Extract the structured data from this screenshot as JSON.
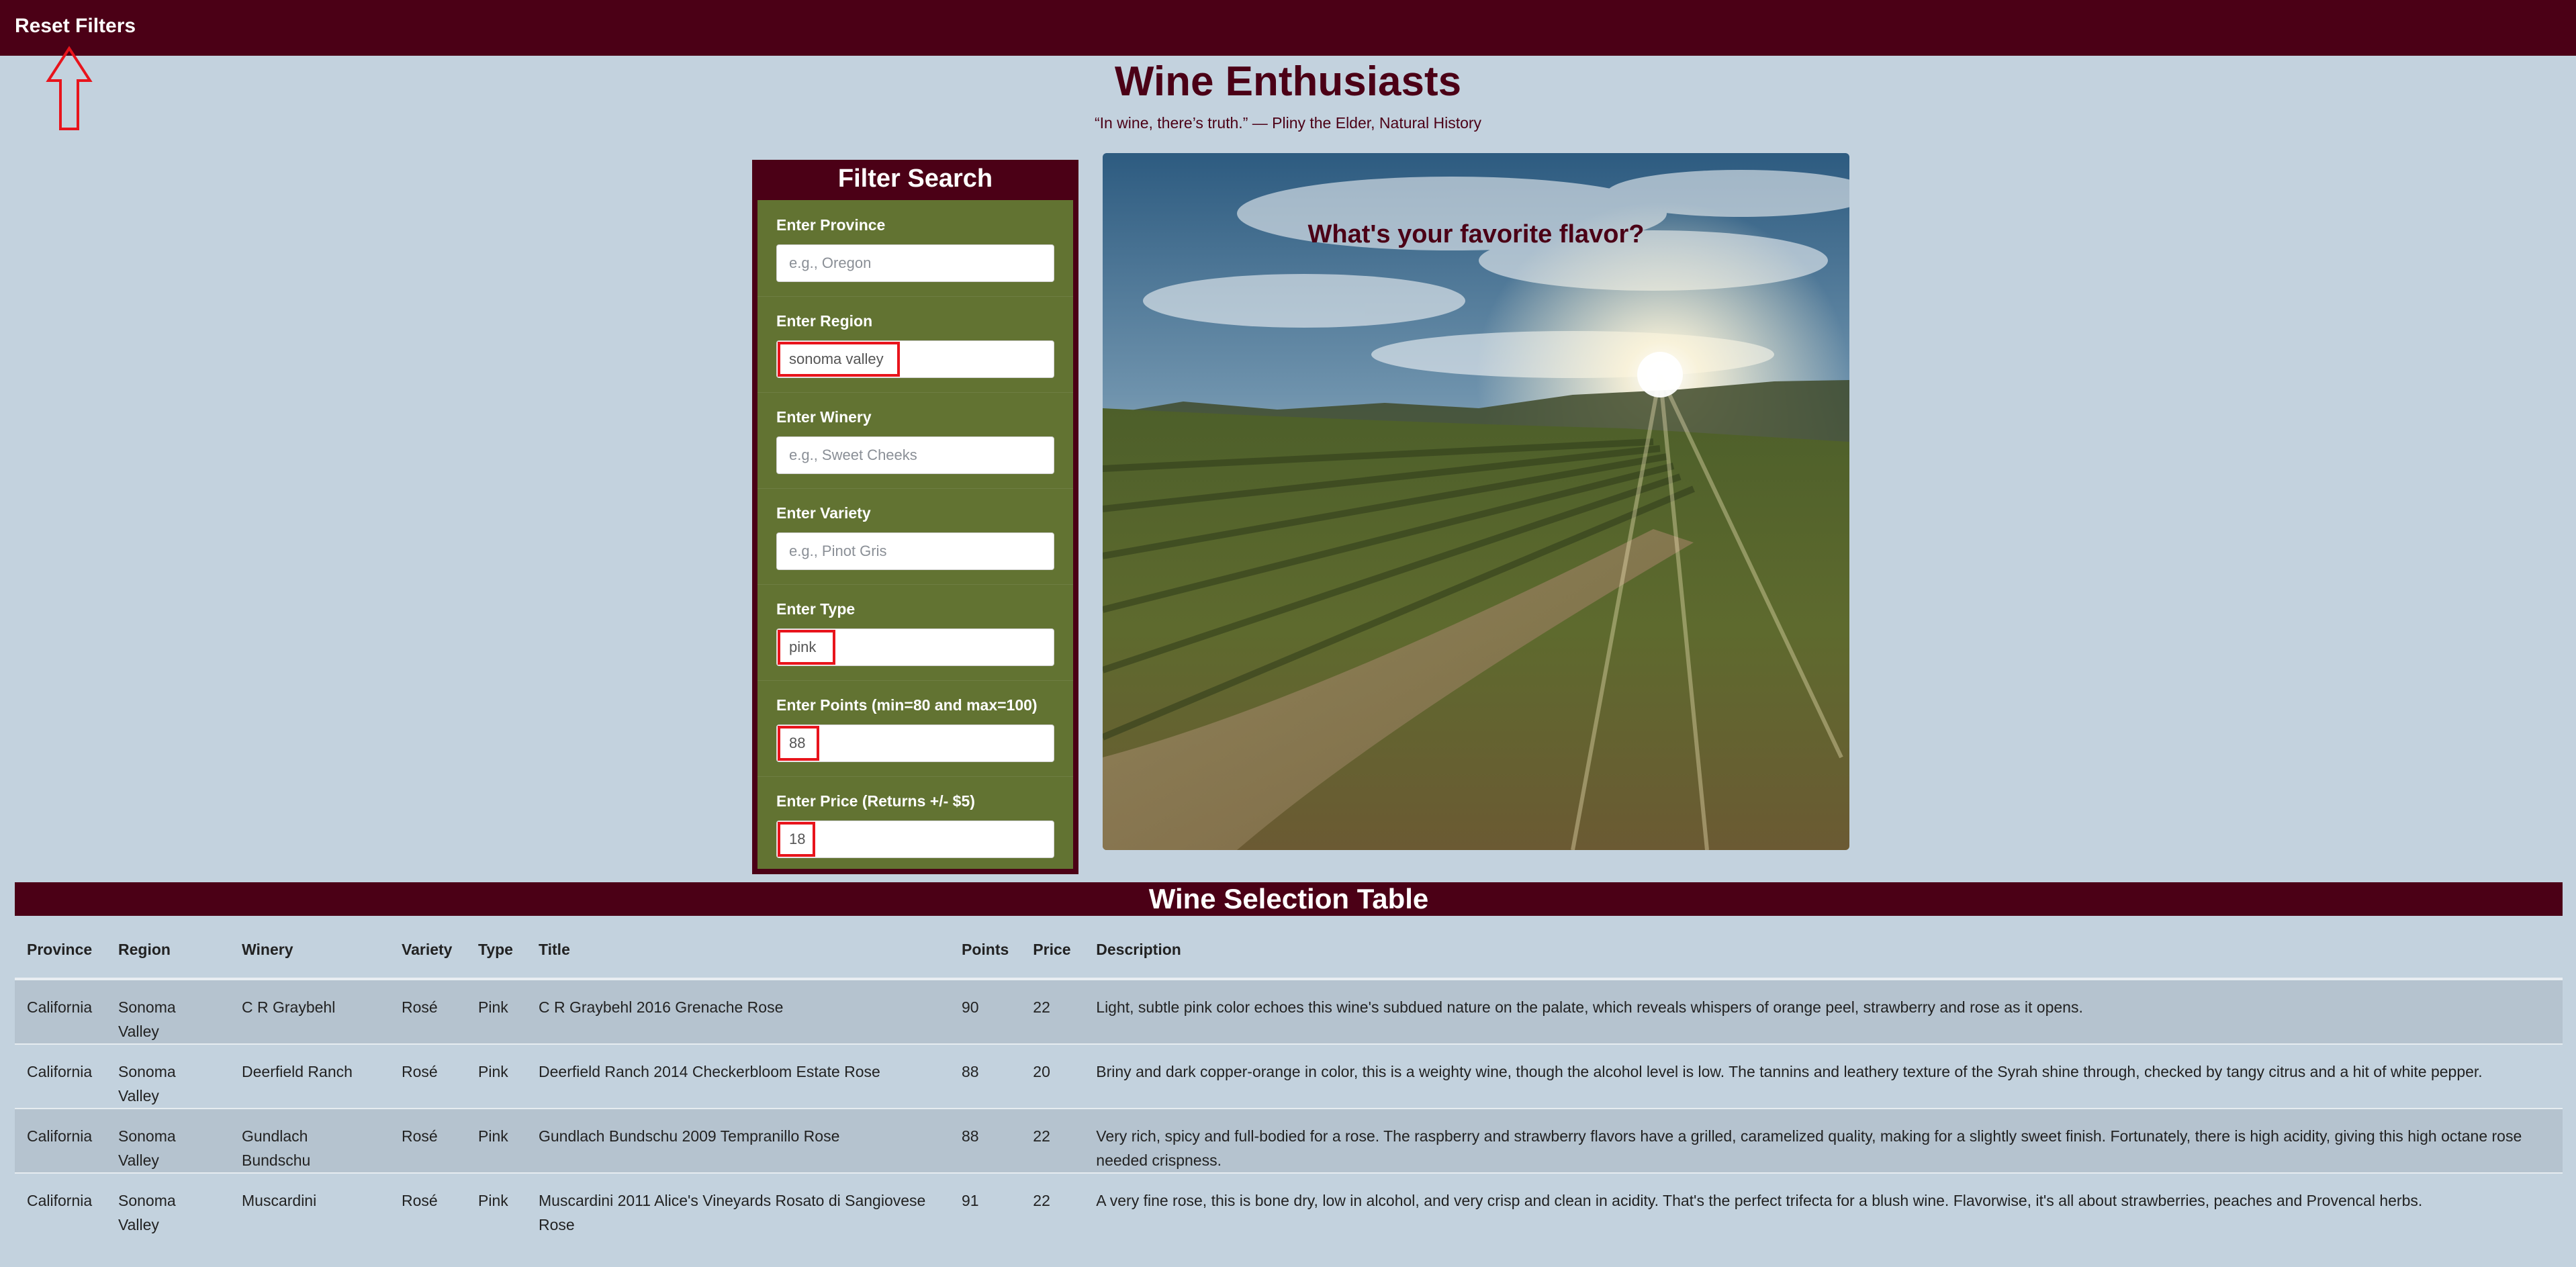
{
  "nav": {
    "reset_label": "Reset Filters"
  },
  "header": {
    "title": "Wine Enthusiasts",
    "quote": "“In wine, there’s truth.” — Pliny the Elder, Natural History"
  },
  "filter": {
    "title": "Filter Search",
    "province": {
      "label": "Enter Province",
      "value": "",
      "placeholder": "e.g., Oregon"
    },
    "region": {
      "label": "Enter Region",
      "value": "sonoma valley",
      "placeholder": ""
    },
    "winery": {
      "label": "Enter Winery",
      "value": "",
      "placeholder": "e.g., Sweet Cheeks"
    },
    "variety": {
      "label": "Enter Variety",
      "value": "",
      "placeholder": "e.g., Pinot Gris"
    },
    "type": {
      "label": "Enter Type",
      "value": "pink",
      "placeholder": ""
    },
    "points": {
      "label": "Enter Points (min=80 and max=100)",
      "value": "88",
      "placeholder": ""
    },
    "price": {
      "label": "Enter Price (Returns +/- $5)",
      "value": "18",
      "placeholder": ""
    }
  },
  "hero": {
    "caption": "What's your favorite flavor?"
  },
  "table": {
    "title": "Wine Selection Table",
    "headers": [
      "Province",
      "Region",
      "Winery",
      "Variety",
      "Type",
      "Title",
      "Points",
      "Price",
      "Description"
    ],
    "rows": [
      {
        "province": "California",
        "region": "Sonoma Valley",
        "winery": "C R Graybehl",
        "variety": "Rosé",
        "type": "Pink",
        "title": "C R Graybehl 2016 Grenache Rose",
        "points": "90",
        "price": "22",
        "description": "Light, subtle pink color echoes this wine's subdued nature on the palate, which reveals whispers of orange peel, strawberry and rose as it opens."
      },
      {
        "province": "California",
        "region": "Sonoma Valley",
        "winery": "Deerfield Ranch",
        "variety": "Rosé",
        "type": "Pink",
        "title": "Deerfield Ranch 2014 Checkerbloom Estate Rose",
        "points": "88",
        "price": "20",
        "description": "Briny and dark copper-orange in color, this is a weighty wine, though the alcohol level is low. The tannins and leathery texture of the Syrah shine through, checked by tangy citrus and a hit of white pepper."
      },
      {
        "province": "California",
        "region": "Sonoma Valley",
        "winery": "Gundlach Bundschu",
        "variety": "Rosé",
        "type": "Pink",
        "title": "Gundlach Bundschu 2009 Tempranillo Rose",
        "points": "88",
        "price": "22",
        "description": "Very rich, spicy and full-bodied for a rose. The raspberry and strawberry flavors have a grilled, caramelized quality, making for a slightly sweet finish. Fortunately, there is high acidity, giving this high octane rose needed crispness."
      },
      {
        "province": "California",
        "region": "Sonoma Valley",
        "winery": "Muscardini",
        "variety": "Rosé",
        "type": "Pink",
        "title": "Muscardini 2011 Alice's Vineyards Rosato di Sangiovese Rose",
        "points": "91",
        "price": "22",
        "description": "A very fine rose, this is bone dry, low in alcohol, and very crisp and clean in acidity. That's the perfect trifecta for a blush wine. Flavorwise, it's all about strawberries, peaches and Provencal herbs."
      }
    ]
  },
  "colors": {
    "nav_bg": "#4b0016",
    "page_bg": "#c3d2de",
    "filter_body_bg": "#627332",
    "highlight": "#e8141c"
  }
}
